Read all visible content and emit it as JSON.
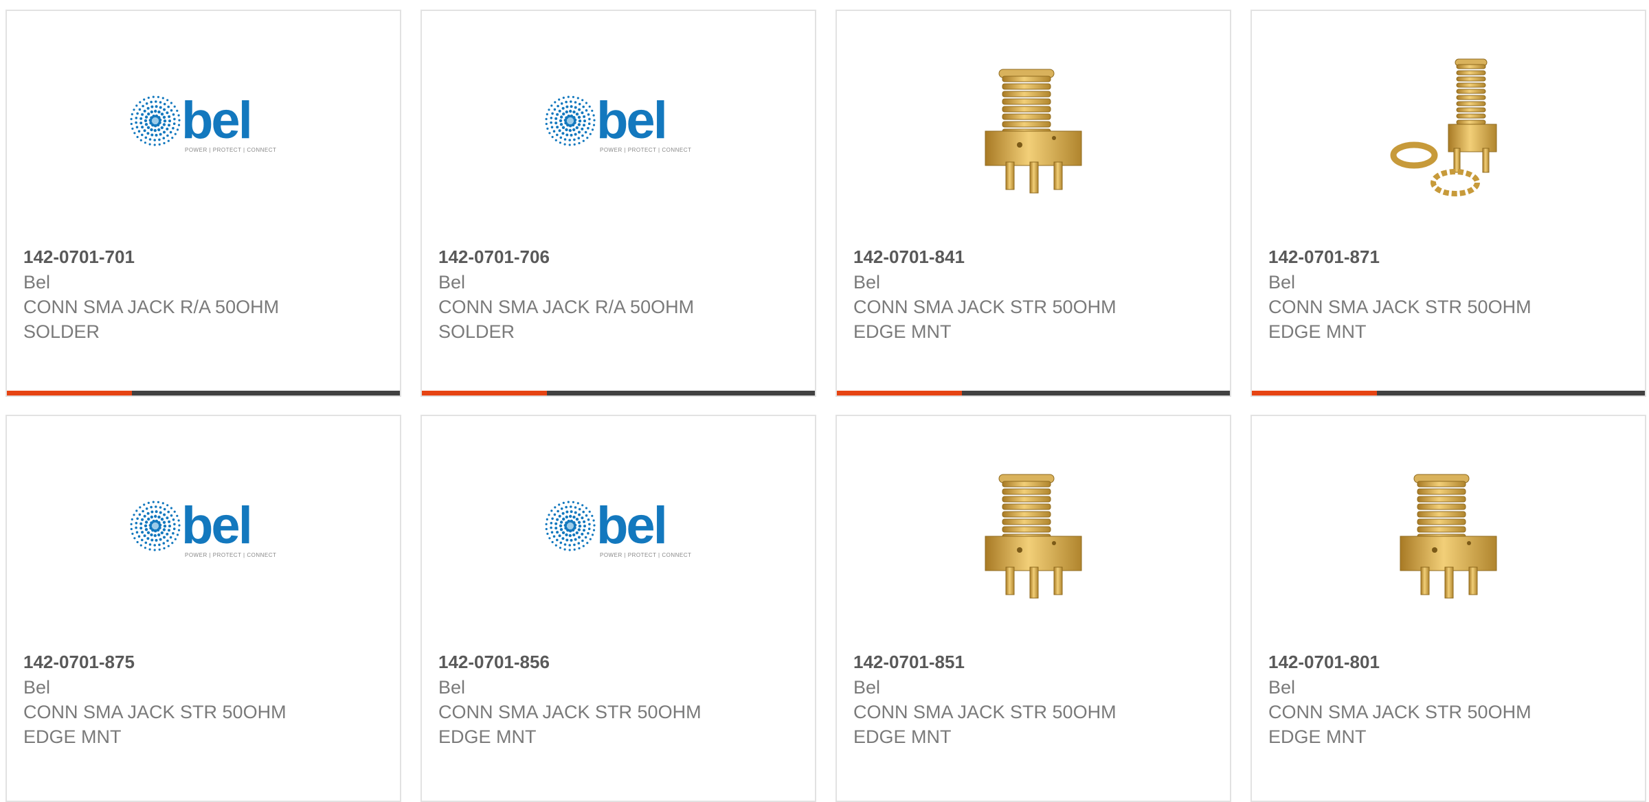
{
  "colors": {
    "accent": "#e64413",
    "bar": "#414141",
    "border": "#e2e2e2",
    "bel_blue": "#1378be"
  },
  "logo": {
    "brand": "bel",
    "tagline": "POWER | PROTECT | CONNECT"
  },
  "products": [
    {
      "part_number": "142-0701-701",
      "manufacturer": "Bel",
      "desc_line1": "CONN SMA JACK R/A 50OHM",
      "desc_line2": "SOLDER",
      "image": "bel-logo-icon",
      "highlight": true
    },
    {
      "part_number": "142-0701-706",
      "manufacturer": "Bel",
      "desc_line1": "CONN SMA JACK R/A 50OHM",
      "desc_line2": "SOLDER",
      "image": "bel-logo-icon",
      "highlight": true
    },
    {
      "part_number": "142-0701-841",
      "manufacturer": "Bel",
      "desc_line1": "CONN SMA JACK STR 50OHM",
      "desc_line2": "EDGE MNT",
      "image": "sma-edge-connector-icon",
      "highlight": true
    },
    {
      "part_number": "142-0701-871",
      "manufacturer": "Bel",
      "desc_line1": "CONN SMA JACK STR 50OHM",
      "desc_line2": "EDGE MNT",
      "image": "sma-connector-with-hardware-icon",
      "highlight": true
    },
    {
      "part_number": "142-0701-875",
      "manufacturer": "Bel",
      "desc_line1": "CONN SMA JACK STR 50OHM",
      "desc_line2": "EDGE MNT",
      "image": "bel-logo-icon",
      "highlight": false
    },
    {
      "part_number": "142-0701-856",
      "manufacturer": "Bel",
      "desc_line1": "CONN SMA JACK STR 50OHM",
      "desc_line2": "EDGE MNT",
      "image": "bel-logo-icon",
      "highlight": false
    },
    {
      "part_number": "142-0701-851",
      "manufacturer": "Bel",
      "desc_line1": "CONN SMA JACK STR 50OHM",
      "desc_line2": "EDGE MNT",
      "image": "sma-edge-connector-icon",
      "highlight": false
    },
    {
      "part_number": "142-0701-801",
      "manufacturer": "Bel",
      "desc_line1": "CONN SMA JACK STR 50OHM",
      "desc_line2": "EDGE MNT",
      "image": "sma-edge-connector-icon",
      "highlight": false
    }
  ]
}
